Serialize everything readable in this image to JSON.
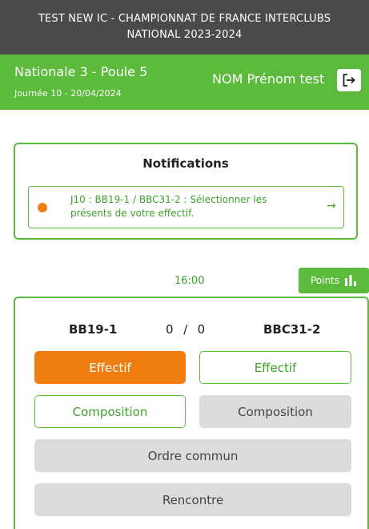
{
  "header": {
    "title_line1": "TEST NEW IC - CHAMPIONNAT DE FRANCE INTERCLUBS",
    "title_line2": "NATIONAL 2023-2024"
  },
  "subheader": {
    "division": "Nationale 3 - Poule 5",
    "journee": "Journée 10 - 20/04/2024",
    "user": "NOM Prénom test",
    "logout_icon": "logout-icon"
  },
  "notifications": {
    "title": "Notifications",
    "items": [
      {
        "text": "J10 : BB19-1 / BBC31-2 : Sélectionner les présents de votre effectif.",
        "status_color": "#ef7d0f",
        "icon": "arrow-right-icon"
      }
    ]
  },
  "match": {
    "time": "16:00",
    "points_label": "Points",
    "points_icon": "bar-chart-icon",
    "home_team": "BB19-1",
    "score": "0  /  0",
    "away_team": "BBC31-2",
    "home_effectif_label": "Effectif",
    "away_effectif_label": "Effectif",
    "home_composition_label": "Composition",
    "away_composition_label": "Composition",
    "ordre_commun_label": "Ordre commun",
    "rencontre_label": "Rencontre"
  },
  "colors": {
    "primary_green": "#5cba3c",
    "text_green": "#3ea12a",
    "accent_orange": "#ef7d0f",
    "header_grey": "#4a4a4a",
    "disabled_grey": "#dcdcdc"
  }
}
